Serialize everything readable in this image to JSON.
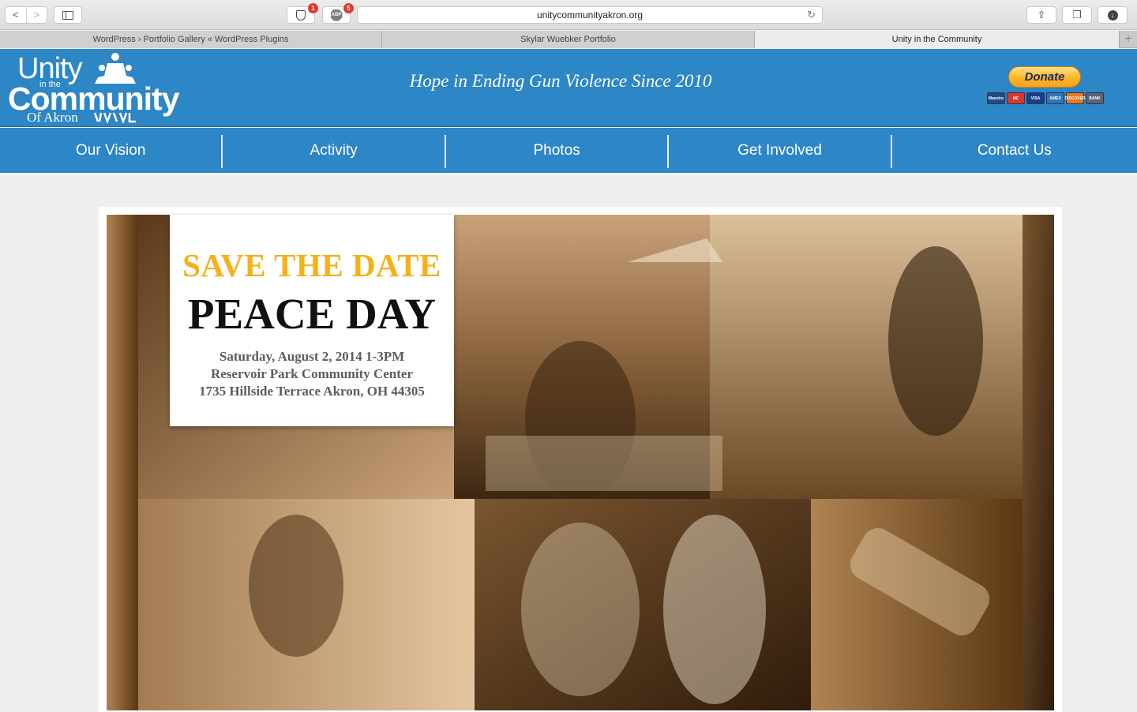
{
  "browser": {
    "url": "unitycommunityakron.org",
    "ext1_badge": "1",
    "ext2_badge": "5",
    "ext2_label": "ABP",
    "back_glyph": "<",
    "forward_glyph": ">",
    "reload_glyph": "↻",
    "share_glyph": "⇪",
    "tabs_glyph": "❐",
    "download_glyph": "↓",
    "new_tab_glyph": "+",
    "tabs": [
      {
        "title": "WordPress › Portfolio Gallery « WordPress Plugins",
        "active": false
      },
      {
        "title": "Skylar Wuebker Portfolio",
        "active": false
      },
      {
        "title": "Unity in the Community",
        "active": true
      }
    ]
  },
  "site": {
    "logo": {
      "unity": "Unity",
      "in_the": "in the",
      "community": "Community",
      "of_akron": "Of Akron"
    },
    "tagline": "Hope in Ending Gun Violence Since 2010",
    "donate_label": "Donate",
    "cards": [
      {
        "label": "Maestro",
        "color": "#1a4d8c"
      },
      {
        "label": "MC",
        "color": "#d8382a"
      },
      {
        "label": "VISA",
        "color": "#1a3c8f"
      },
      {
        "label": "AMEX",
        "color": "#2e77bb"
      },
      {
        "label": "DISCOVER",
        "color": "#e87722"
      },
      {
        "label": "BANK",
        "color": "#5b6475"
      }
    ],
    "nav": [
      "Our Vision",
      "Activity",
      "Photos",
      "Get Involved",
      "Contact Us"
    ]
  },
  "hero": {
    "save_the_date": "SAVE THE DATE",
    "event_title": "PEACE DAY",
    "date_time": "Saturday, August 2, 2014 1-3PM",
    "venue": "Reservoir Park Community Center",
    "address": "1735 Hillside Terrace Akron, OH 44305"
  },
  "colors": {
    "brand_blue": "#2d86c5",
    "accent_gold": "#f5b117",
    "sepia_dark": "#3a2410",
    "sepia_light": "#d9b48a"
  }
}
